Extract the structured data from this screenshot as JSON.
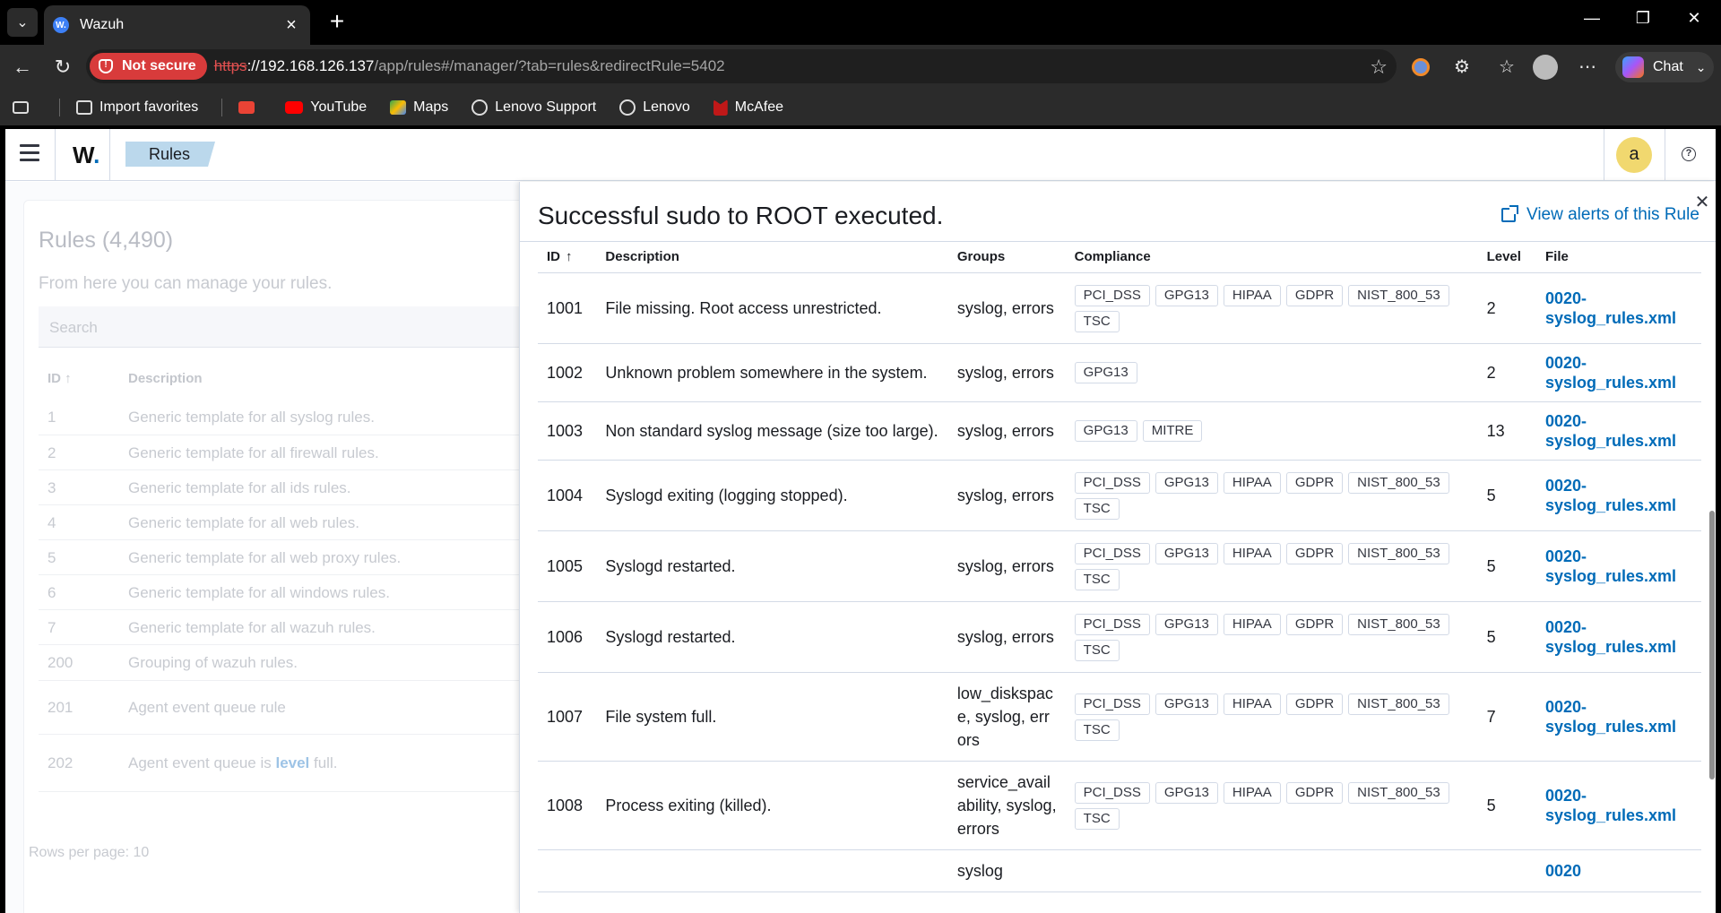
{
  "browser": {
    "tab_title": "Wazuh",
    "favicon_text": "W.",
    "not_secure": "Not secure",
    "url_scheme": "https",
    "url_host": "://192.168.126.137",
    "url_path": "/app/rules#/manager/?tab=rules&redirectRule=5402",
    "chat_label": "Chat"
  },
  "bookmarks": [
    {
      "label": "Import favorites",
      "icon": "folder-icon",
      "color": "#cfcfcf"
    },
    {
      "label": "",
      "icon": "gmail-icon",
      "color": "#ea4335"
    },
    {
      "label": "YouTube",
      "icon": "youtube-icon",
      "color": "#ff0000"
    },
    {
      "label": "Maps",
      "icon": "maps-icon",
      "color": "#34a853"
    },
    {
      "label": "Lenovo Support",
      "icon": "globe-icon",
      "color": "#cfcfcf"
    },
    {
      "label": "Lenovo",
      "icon": "globe-icon",
      "color": "#cfcfcf"
    },
    {
      "label": "McAfee",
      "icon": "mcafee-icon",
      "color": "#c01818"
    }
  ],
  "app": {
    "logo": "W",
    "breadcrumb": "Rules",
    "avatar_letter": "a",
    "colors": {
      "accent": "#006bb8",
      "breadcrumb_bg": "#bbd8ec",
      "avatar_bg": "#f1d86f"
    }
  },
  "background": {
    "title": "Rules (4,490)",
    "subtitle": "From here you can manage your rules.",
    "search_placeholder": "Search",
    "col_id": "ID",
    "col_desc": "Description",
    "rows": [
      {
        "id": "1",
        "desc": "Generic template for all syslog rules."
      },
      {
        "id": "2",
        "desc": "Generic template for all firewall rules."
      },
      {
        "id": "3",
        "desc": "Generic template for all ids rules."
      },
      {
        "id": "4",
        "desc": "Generic template for all web rules."
      },
      {
        "id": "5",
        "desc": "Generic template for all web proxy rules."
      },
      {
        "id": "6",
        "desc": "Generic template for all windows rules."
      },
      {
        "id": "7",
        "desc": "Generic template for all wazuh rules."
      },
      {
        "id": "200",
        "desc": "Grouping of wazuh rules."
      },
      {
        "id": "201",
        "desc": "Agent event queue rule"
      },
      {
        "id": "202",
        "desc_pre": "Agent event queue is ",
        "desc_bold": "level",
        "desc_post": " full."
      }
    ],
    "footer": "Rows per page: 10"
  },
  "flyout": {
    "title": "Successful sudo to ROOT executed.",
    "view_alerts": "View alerts of this Rule",
    "columns": {
      "id": "ID",
      "description": "Description",
      "groups": "Groups",
      "compliance": "Compliance",
      "level": "Level",
      "file": "File"
    },
    "rows": [
      {
        "id": "1001",
        "description": "File missing. Root access unrestricted.",
        "groups": "syslog, errors",
        "compliance": [
          "PCI_DSS",
          "GPG13",
          "HIPAA",
          "GDPR",
          "NIST_800_53",
          "TSC"
        ],
        "level": "2",
        "file": "0020-syslog_rules.xml"
      },
      {
        "id": "1002",
        "description": "Unknown problem somewhere in the system.",
        "groups": "syslog, errors",
        "compliance": [
          "GPG13"
        ],
        "level": "2",
        "file": "0020-syslog_rules.xml"
      },
      {
        "id": "1003",
        "description": "Non standard syslog message (size too large).",
        "groups": "syslog, errors",
        "compliance": [
          "GPG13",
          "MITRE"
        ],
        "level": "13",
        "file": "0020-syslog_rules.xml"
      },
      {
        "id": "1004",
        "description": "Syslogd exiting (logging stopped).",
        "groups": "syslog, errors",
        "compliance": [
          "PCI_DSS",
          "GPG13",
          "HIPAA",
          "GDPR",
          "NIST_800_53",
          "TSC"
        ],
        "level": "5",
        "file": "0020-syslog_rules.xml"
      },
      {
        "id": "1005",
        "description": "Syslogd restarted.",
        "groups": "syslog, errors",
        "compliance": [
          "PCI_DSS",
          "GPG13",
          "HIPAA",
          "GDPR",
          "NIST_800_53",
          "TSC"
        ],
        "level": "5",
        "file": "0020-syslog_rules.xml"
      },
      {
        "id": "1006",
        "description": "Syslogd restarted.",
        "groups": "syslog, errors",
        "compliance": [
          "PCI_DSS",
          "GPG13",
          "HIPAA",
          "GDPR",
          "NIST_800_53",
          "TSC"
        ],
        "level": "5",
        "file": "0020-syslog_rules.xml"
      },
      {
        "id": "1007",
        "description": "File system full.",
        "groups": "low_diskspace, syslog, errors",
        "compliance": [
          "PCI_DSS",
          "GPG13",
          "HIPAA",
          "GDPR",
          "NIST_800_53",
          "TSC"
        ],
        "level": "7",
        "file": "0020-syslog_rules.xml"
      },
      {
        "id": "1008",
        "description": "Process exiting (killed).",
        "groups": "service_availability, syslog, errors",
        "compliance": [
          "PCI_DSS",
          "GPG13",
          "HIPAA",
          "GDPR",
          "NIST_800_53",
          "TSC"
        ],
        "level": "5",
        "file": "0020-syslog_rules.xml"
      },
      {
        "id": "",
        "description": "",
        "groups": "syslog",
        "compliance": [],
        "level": "",
        "file": "0020"
      }
    ]
  }
}
